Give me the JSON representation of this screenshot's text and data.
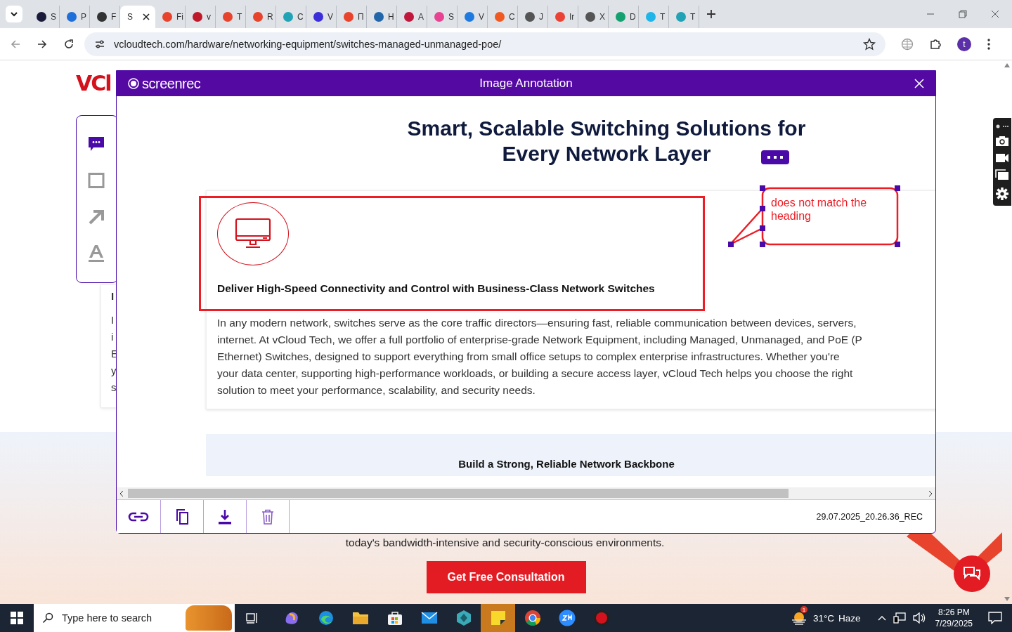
{
  "browser": {
    "tabs": [
      {
        "label": "S",
        "selected": false,
        "color": "#1a1a3a"
      },
      {
        "label": "P",
        "selected": false,
        "color": "#1e6fd9"
      },
      {
        "label": "F",
        "selected": false,
        "color": "#333333"
      },
      {
        "label": "S",
        "selected": true
      },
      {
        "label": "Fi",
        "selected": false,
        "color": "#e8432c"
      },
      {
        "label": "v",
        "selected": false,
        "color": "#c0182b"
      },
      {
        "label": "T",
        "selected": false,
        "color": "#e8432c"
      },
      {
        "label": "R",
        "selected": false,
        "color": "#e8432c"
      },
      {
        "label": "C",
        "selected": false,
        "color": "#22a3b5"
      },
      {
        "label": "V",
        "selected": false,
        "color": "#3b2fd9"
      },
      {
        "label": "П",
        "selected": false,
        "color": "#e8432c"
      },
      {
        "label": "H",
        "selected": false,
        "color": "#2266aa"
      },
      {
        "label": "A",
        "selected": false,
        "color": "#c0183c"
      },
      {
        "label": "S",
        "selected": false,
        "color": "#e84393"
      },
      {
        "label": "V",
        "selected": false,
        "color": "#1f7ae0"
      },
      {
        "label": "C",
        "selected": false,
        "color": "#f05a22"
      },
      {
        "label": "J",
        "selected": false,
        "color": "#555555"
      },
      {
        "label": "Ir",
        "selected": false,
        "color": "#ea4335"
      },
      {
        "label": "X",
        "selected": false,
        "color": "#555555"
      },
      {
        "label": "D",
        "selected": false,
        "color": "#14a06f"
      },
      {
        "label": "T",
        "selected": false,
        "color": "#1fb5e8"
      },
      {
        "label": "T",
        "selected": false,
        "color": "#22a3b5"
      }
    ],
    "url": "vcloudtech.com/hardware/networking-equipment/switches-managed-unmanaged-poe/",
    "profile_initial": "t"
  },
  "page": {
    "logo": "VCl",
    "card_fragments": [
      "I",
      "I",
      "i",
      "E",
      "y",
      "s"
    ],
    "footer_text": "today's bandwidth-intensive and security-conscious environments.",
    "cta_button": "Get Free Consultation"
  },
  "annotation_tools": [
    {
      "kind": "comment",
      "selected": true
    },
    {
      "kind": "rectangle",
      "selected": false
    },
    {
      "kind": "arrow",
      "selected": false
    },
    {
      "kind": "text",
      "selected": false
    }
  ],
  "modal": {
    "brand": "screenrec",
    "title": "Image Annotation",
    "heading_lines": [
      "Smart, Scalable Switching Solutions for",
      "Every Network Layer"
    ],
    "card_title": "Deliver High-Speed Connectivity and Control with Business-Class Network Switches",
    "card_lines": [
      "In any modern network, switches serve as the core traffic directors—ensuring fast, reliable communication between devices, servers,",
      "internet. At vCloud Tech, we offer a full portfolio of enterprise-grade Network Equipment, including Managed, Unmanaged, and PoE (P",
      "Ethernet) Switches, designed to support everything from small office setups to complex enterprise infrastructures. Whether you're",
      "your data center, supporting high-performance workloads, or building a secure access layer, vCloud Tech helps you choose the right",
      "solution to meet your performance, scalability, and security needs."
    ],
    "band_heading": "Build a Strong, Reliable Network Backbone",
    "callout_text": "does not match the heading",
    "footer_actions": [
      {
        "kind": "link"
      },
      {
        "kind": "copy"
      },
      {
        "kind": "download"
      },
      {
        "kind": "delete"
      }
    ],
    "filename": "29.07.2025_20.26.36_REC"
  },
  "taskbar": {
    "search_placeholder": "Type here to search",
    "apps": [
      {
        "kind": "copilot",
        "selected": false
      },
      {
        "kind": "edge",
        "selected": false
      },
      {
        "kind": "folder",
        "selected": false
      },
      {
        "kind": "store",
        "selected": false
      },
      {
        "kind": "mail",
        "selected": false
      },
      {
        "kind": "hex",
        "selected": false
      },
      {
        "kind": "sticky",
        "selected": true
      },
      {
        "kind": "chrome",
        "selected": false
      },
      {
        "kind": "zoom",
        "selected": false
      },
      {
        "kind": "record",
        "selected": false
      }
    ],
    "weather_badge": "1",
    "weather": "31°C",
    "weather_desc": "Haze",
    "time": "8:26 PM",
    "date": "7/29/2025"
  }
}
